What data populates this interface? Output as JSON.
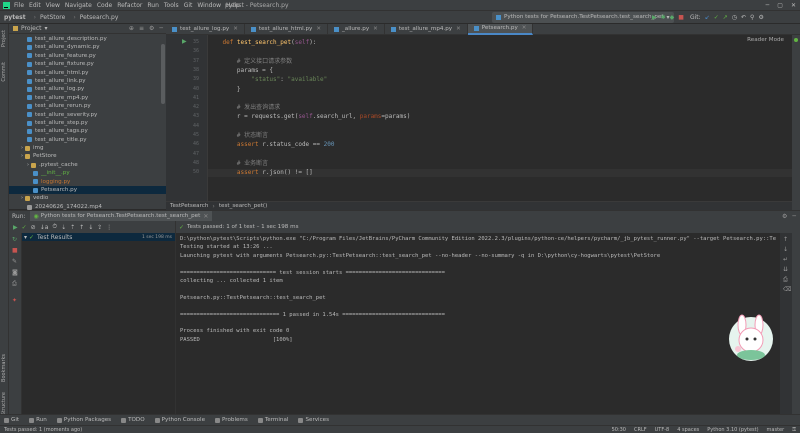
{
  "titlebar": {
    "menu": [
      "File",
      "Edit",
      "View",
      "Navigate",
      "Code",
      "Refactor",
      "Run",
      "Tools",
      "Git",
      "Window",
      "Help"
    ],
    "title": "pytest - Petsearch.py"
  },
  "nav": {
    "breadcrumbs": [
      "pytest",
      "PetStore",
      "Petsearch.py"
    ],
    "run_config": "Python tests for Petsearch.TestPetsearch.test_search_pet",
    "git_label": "Git:"
  },
  "project": {
    "title": "Project",
    "items": [
      {
        "label": "test_allure_description.py",
        "kind": "py",
        "indent": 1
      },
      {
        "label": "test_allure_dynamic.py",
        "kind": "py",
        "indent": 1
      },
      {
        "label": "test_allure_feature.py",
        "kind": "py",
        "indent": 1
      },
      {
        "label": "test_allure_fixture.py",
        "kind": "py",
        "indent": 1
      },
      {
        "label": "test_allure_html.py",
        "kind": "py",
        "indent": 1
      },
      {
        "label": "test_allure_link.py",
        "kind": "py",
        "indent": 1
      },
      {
        "label": "test_allure_log.py",
        "kind": "py",
        "indent": 1
      },
      {
        "label": "test_allure_mp4.py",
        "kind": "py",
        "indent": 1
      },
      {
        "label": "test_allure_rerun.py",
        "kind": "py",
        "indent": 1
      },
      {
        "label": "test_allure_severity.py",
        "kind": "py",
        "indent": 1
      },
      {
        "label": "test_allure_step.py",
        "kind": "py",
        "indent": 1
      },
      {
        "label": "test_allure_tags.py",
        "kind": "py",
        "indent": 1
      },
      {
        "label": "test_allure_title.py",
        "kind": "py",
        "indent": 1
      },
      {
        "label": "img",
        "kind": "dir",
        "indent": 0
      },
      {
        "label": "PetStore",
        "kind": "dir",
        "indent": 0
      },
      {
        "label": ".pytest_cache",
        "kind": "dir",
        "indent": 1
      },
      {
        "label": "__init__.py",
        "kind": "py",
        "indent": 2,
        "color": "green"
      },
      {
        "label": "logging.py",
        "kind": "py",
        "indent": 2,
        "color": "orange"
      },
      {
        "label": "Petsearch.py",
        "kind": "py",
        "indent": 2,
        "selected": true
      },
      {
        "label": "vedio",
        "kind": "dir",
        "indent": 0
      },
      {
        "label": "20240626_174022.mp4",
        "kind": "file",
        "indent": 1
      }
    ]
  },
  "editor": {
    "tabs": [
      {
        "label": "test_allure_log.py",
        "active": false
      },
      {
        "label": "test_allure_html.py",
        "active": false
      },
      {
        "label": "_allure.py",
        "active": false
      },
      {
        "label": "test_allure_mp4.py",
        "active": false
      },
      {
        "label": "Petsearch.py",
        "active": true
      }
    ],
    "reader_mode": "Reader Mode",
    "lines": [
      {
        "num": "35",
        "code": "    def test_search_pet(self):"
      },
      {
        "num": "36",
        "code": ""
      },
      {
        "num": "37",
        "code": "        # 定义接口请求参数"
      },
      {
        "num": "38",
        "code": "        params = {"
      },
      {
        "num": "39",
        "code": "            \"status\": \"available\""
      },
      {
        "num": "40",
        "code": "        }"
      },
      {
        "num": "41",
        "code": ""
      },
      {
        "num": "42",
        "code": "        # 发出查询请求"
      },
      {
        "num": "43",
        "code": "        r = requests.get(self.search_url, params=params)"
      },
      {
        "num": "44",
        "code": ""
      },
      {
        "num": "45",
        "code": "        # 状态断言"
      },
      {
        "num": "46",
        "code": "        assert r.status_code == 200"
      },
      {
        "num": "47",
        "code": ""
      },
      {
        "num": "48",
        "code": "        # 业务断言"
      },
      {
        "num": "50",
        "code": "        assert r.json() != []"
      }
    ],
    "breadcrumb": [
      "TestPetsearch",
      "test_search_pet()"
    ]
  },
  "run": {
    "tab_label": "Run:",
    "config_tab": "Python tests for Petsearch.TestPetsearch.test_search_pet",
    "test_status": "Tests passed: 1 of 1 test – 1 sec 198 ms",
    "tree_root": "Test Results",
    "tree_time": "1 sec 198 ms",
    "console": [
      "D:\\python\\pytest\\Scripts\\python.exe \"C:/Program Files/JetBrains/PyCharm Community Edition 2022.2.3/plugins/python-ce/helpers/pycharm/_jb_pytest_runner.py\" --target Petsearch.py::Te",
      "Testing started at 13:26 ...",
      "Launching pytest with arguments Petsearch.py::TestPetsearch::test_search_pet --no-header --no-summary -q in D:\\python\\cy-hogwarts\\pytest\\PetStore",
      "",
      "============================= test session starts ==============================",
      "collecting ... collected 1 item",
      "",
      "Petsearch.py::TestPetsearch::test_search_pet",
      "",
      "============================== 1 passed in 1.54s ===============================",
      "",
      "Process finished with exit code 0",
      "PASSED                      [100%]"
    ]
  },
  "bottom_tools": [
    "Git",
    "Run",
    "Python Packages",
    "TODO",
    "Python Console",
    "Problems",
    "Terminal",
    "Services"
  ],
  "status": {
    "left": "Tests passed: 1 (moments ago)",
    "right": [
      "50:30",
      "CRLF",
      "UTF-8",
      "4 spaces",
      "Python 3.10 (pytest)",
      "master"
    ]
  },
  "colors": {
    "accent": "#4a88c7",
    "success": "#62b543",
    "selection": "#0d293e"
  }
}
